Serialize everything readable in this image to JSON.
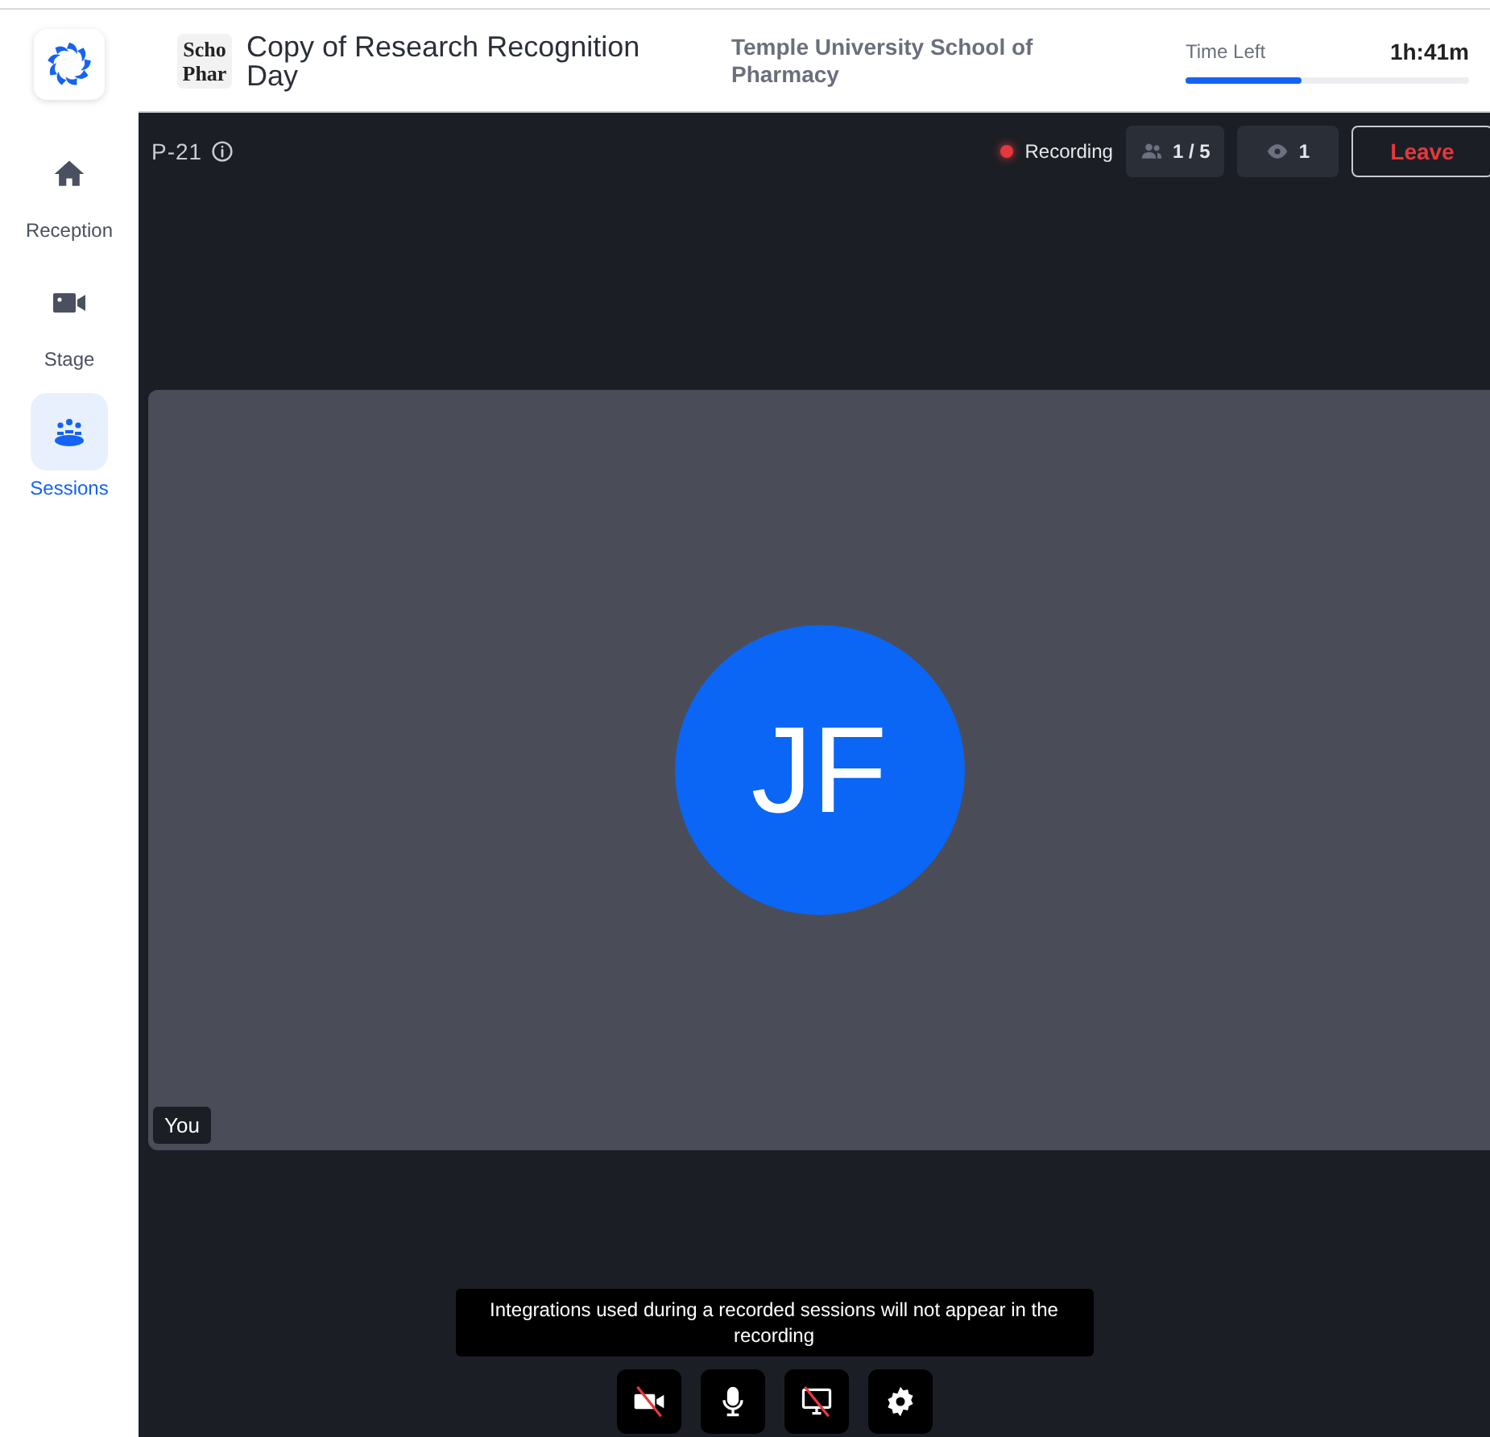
{
  "sidebar": {
    "items": [
      {
        "label": "Reception",
        "kind": "home",
        "selected": false
      },
      {
        "label": "Stage",
        "kind": "stage",
        "selected": false
      },
      {
        "label": "Sessions",
        "kind": "sessions",
        "selected": true
      }
    ]
  },
  "header": {
    "logo_text": [
      "Scho",
      "Phar"
    ],
    "title": "Copy of Research Recognition Day",
    "organizer": "Temple University School of Pharmacy",
    "timer": {
      "label": "Time Left",
      "value": "1h:41m",
      "level": 0.41
    }
  },
  "session": {
    "room": "P-21",
    "recording": {
      "label": "Recording",
      "on": true
    },
    "attendees": "1 / 5",
    "viewers": "1",
    "leave": "Leave"
  },
  "tile": {
    "initials": "JF",
    "name": "You"
  },
  "tooltip": "Integrations used during a recorded sessions will not appear in the recording",
  "controls": [
    {
      "kind": "camera",
      "off": true
    },
    {
      "kind": "mic",
      "off": false
    },
    {
      "kind": "screen",
      "off": true
    },
    {
      "kind": "settings",
      "off": false
    }
  ]
}
